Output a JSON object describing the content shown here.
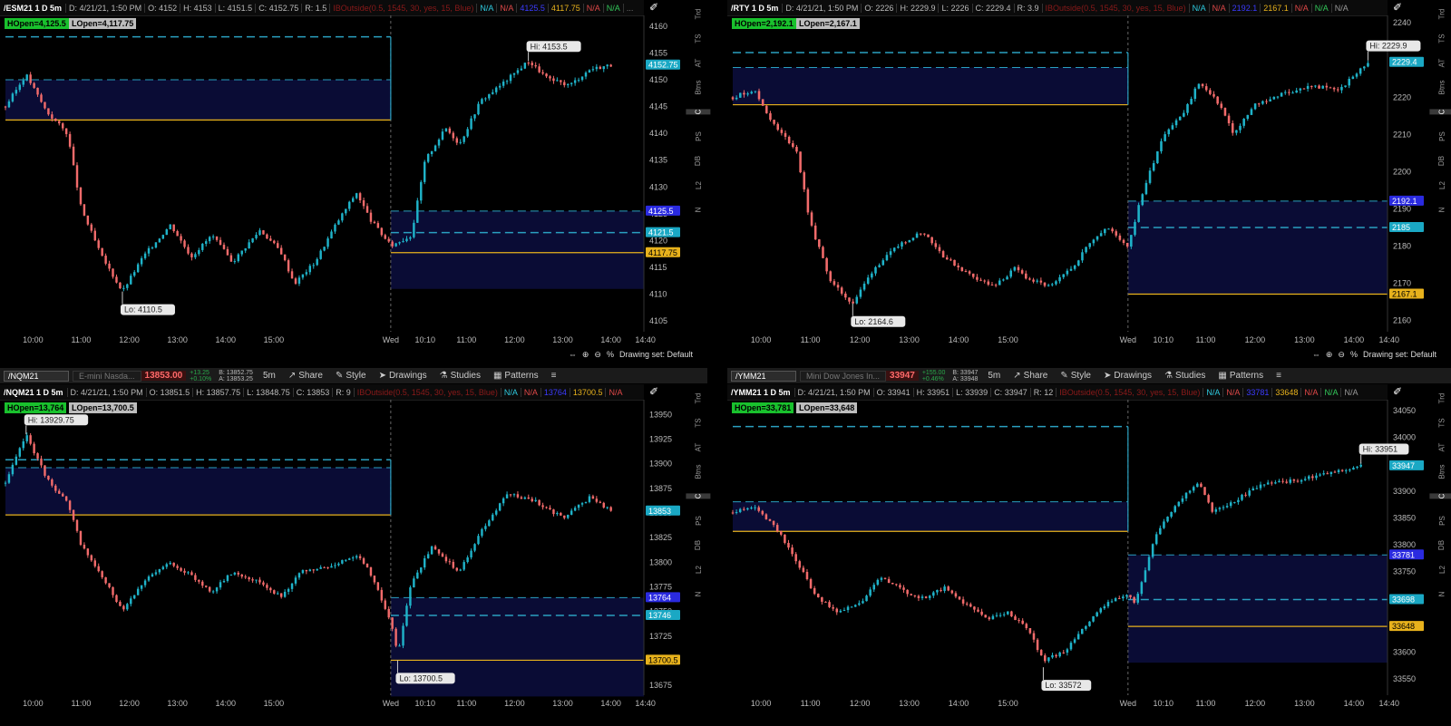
{
  "panels": [
    {
      "id": "esm",
      "symbol": "/ESM21 1 D 5m",
      "toolbar": null,
      "header_items": [
        {
          "t": "D: 4/21/21, 1:50 PM",
          "c": "it"
        },
        {
          "t": "O: 4152",
          "c": "it"
        },
        {
          "t": "H: 4153",
          "c": "it"
        },
        {
          "t": "L: 4151.5",
          "c": "it"
        },
        {
          "t": "C: 4152.75",
          "c": "it"
        },
        {
          "t": "R: 1.5",
          "c": "it"
        },
        {
          "t": "IBOutside(0.5, 1545, 30, yes, 15, Blue)",
          "c": "st"
        },
        {
          "t": "N/A",
          "c": "na-c"
        },
        {
          "t": "N/A",
          "c": "na-r"
        },
        {
          "t": "4125.5",
          "c": "bl"
        },
        {
          "t": "4117.75",
          "c": "yl"
        },
        {
          "t": "N/A",
          "c": "na-r"
        },
        {
          "t": "N/A",
          "c": "na-g"
        },
        {
          "t": "...",
          "c": "dots"
        }
      ],
      "hopen": "HOpen=4,125.5",
      "lopen": "LOpen=4,117.75",
      "y_ticks": [
        4160,
        4155,
        4150,
        4145,
        4140,
        4135,
        4130,
        4125,
        4120,
        4115,
        4110,
        4105
      ],
      "x_ticks": [
        "10:00",
        "11:00",
        "12:00",
        "13:00",
        "14:00",
        "15:00",
        "Wed",
        "10:10",
        "11:00",
        "12:00",
        "13:00",
        "14:00",
        "14:40"
      ],
      "price_tags": [
        {
          "v": "4152.75",
          "bg": "#1aa8c4",
          "fg": "#fff"
        },
        {
          "v": "4125.5",
          "bg": "#2a2ae0",
          "fg": "#fff"
        },
        {
          "v": "4121.5",
          "bg": "#1aa8c4",
          "fg": "#fff"
        },
        {
          "v": "4117.75",
          "bg": "#e8b21c",
          "fg": "#000"
        }
      ],
      "hi_label": "Hi: 4153.5",
      "lo_label": "Lo: 4110.5",
      "status": "Drawing set: Default",
      "side_buttons": [
        "Trd",
        "TS",
        "AT",
        "Btns",
        "C",
        "PS",
        "DB",
        "L2",
        "N"
      ],
      "colors": {
        "up": "#1fb3c9",
        "down": "#f26b6b",
        "ib_fill": "#0a0c35",
        "ib_line": "#2aa0c0",
        "lopen_line": "#e8b21c"
      },
      "chart_data": {
        "type": "candlestick",
        "title": "/ESM21 1 D 5m",
        "ylim": [
          4103,
          4162
        ],
        "day_split_fraction": 0.56,
        "y_levels": {
          "ib_high_prev": 4158,
          "ib_fill_top_prev": 4150,
          "lopen_prev": 4142.5,
          "ib_high": 4125.5,
          "ib_mid": 4121.5,
          "lopen": 4117.75
        },
        "hi": 4153.5,
        "lo": 4110.5,
        "path": [
          [
            0,
            4145
          ],
          [
            0.03,
            4151
          ],
          [
            0.06,
            4144
          ],
          [
            0.09,
            4140
          ],
          [
            0.11,
            4126
          ],
          [
            0.14,
            4117
          ],
          [
            0.17,
            4110.5
          ],
          [
            0.2,
            4117
          ],
          [
            0.24,
            4123
          ],
          [
            0.27,
            4117
          ],
          [
            0.3,
            4121
          ],
          [
            0.33,
            4116
          ],
          [
            0.37,
            4122
          ],
          [
            0.4,
            4118
          ],
          [
            0.42,
            4112
          ],
          [
            0.45,
            4116
          ],
          [
            0.48,
            4123
          ],
          [
            0.51,
            4129
          ],
          [
            0.53,
            4124
          ],
          [
            0.56,
            4119
          ],
          [
            0.59,
            4121
          ],
          [
            0.61,
            4135
          ],
          [
            0.64,
            4141
          ],
          [
            0.66,
            4138
          ],
          [
            0.69,
            4146
          ],
          [
            0.72,
            4149
          ],
          [
            0.76,
            4153.5
          ],
          [
            0.79,
            4150
          ],
          [
            0.82,
            4149
          ],
          [
            0.85,
            4152
          ],
          [
            0.88,
            4152.75
          ]
        ]
      }
    },
    {
      "id": "rty",
      "symbol": "/RTY 1 D 5m",
      "toolbar": null,
      "header_items": [
        {
          "t": "D: 4/21/21, 1:50 PM",
          "c": "it"
        },
        {
          "t": "O: 2226",
          "c": "it"
        },
        {
          "t": "H: 2229.9",
          "c": "it"
        },
        {
          "t": "L: 2226",
          "c": "it"
        },
        {
          "t": "C: 2229.4",
          "c": "it"
        },
        {
          "t": "R: 3.9",
          "c": "it"
        },
        {
          "t": "IBOutside(0.5, 1545, 30, yes, 15, Blue)",
          "c": "st"
        },
        {
          "t": "N/A",
          "c": "na-c"
        },
        {
          "t": "N/A",
          "c": "na-r"
        },
        {
          "t": "2192.1",
          "c": "bl"
        },
        {
          "t": "2167.1",
          "c": "yl"
        },
        {
          "t": "N/A",
          "c": "na-r"
        },
        {
          "t": "N/A",
          "c": "na-g"
        },
        {
          "t": "N/A",
          "c": "na-w"
        }
      ],
      "hopen": "HOpen=2,192.1",
      "lopen": "LOpen=2,167.1",
      "y_ticks": [
        2240,
        2230,
        2220,
        2210,
        2200,
        2190,
        2180,
        2170,
        2160
      ],
      "x_ticks": [
        "10:00",
        "11:00",
        "12:00",
        "13:00",
        "14:00",
        "15:00",
        "Wed",
        "10:10",
        "11:00",
        "12:00",
        "13:00",
        "14:00",
        "14:40"
      ],
      "price_tags": [
        {
          "v": "2229.4",
          "bg": "#1aa8c4",
          "fg": "#fff"
        },
        {
          "v": "2192.1",
          "bg": "#2a2ae0",
          "fg": "#fff"
        },
        {
          "v": "2185",
          "bg": "#1aa8c4",
          "fg": "#fff"
        },
        {
          "v": "2167.1",
          "bg": "#e8b21c",
          "fg": "#000"
        }
      ],
      "hi_label": "Hi: 2229.9",
      "lo_label": "Lo: 2164.6",
      "status": "Drawing set: Default",
      "side_buttons": [
        "Trd",
        "TS",
        "AT",
        "Btns",
        "C",
        "PS",
        "DB",
        "L2",
        "N"
      ],
      "colors": {
        "up": "#1fb3c9",
        "down": "#f26b6b",
        "ib_fill": "#0a0c35",
        "ib_line": "#2aa0c0",
        "lopen_line": "#e8b21c"
      },
      "chart_data": {
        "type": "candlestick",
        "title": "/RTY 1 D 5m",
        "ylim": [
          2157,
          2242
        ],
        "day_split_fraction": 0.56,
        "y_levels": {
          "ib_high_prev": 2232,
          "ib_fill_top_prev": 2228,
          "lopen_prev": 2218,
          "ib_high": 2192.1,
          "ib_mid": 2185,
          "lopen": 2167.1
        },
        "hi": 2229.9,
        "lo": 2164.6,
        "path": [
          [
            0,
            2220
          ],
          [
            0.03,
            2222
          ],
          [
            0.06,
            2212
          ],
          [
            0.09,
            2206
          ],
          [
            0.11,
            2186
          ],
          [
            0.14,
            2170
          ],
          [
            0.17,
            2164.6
          ],
          [
            0.2,
            2174
          ],
          [
            0.24,
            2181
          ],
          [
            0.27,
            2184
          ],
          [
            0.3,
            2177
          ],
          [
            0.33,
            2173
          ],
          [
            0.37,
            2169
          ],
          [
            0.4,
            2174
          ],
          [
            0.42,
            2171
          ],
          [
            0.45,
            2169
          ],
          [
            0.48,
            2174
          ],
          [
            0.51,
            2182
          ],
          [
            0.53,
            2185
          ],
          [
            0.56,
            2180
          ],
          [
            0.58,
            2194
          ],
          [
            0.61,
            2210
          ],
          [
            0.64,
            2216
          ],
          [
            0.66,
            2224
          ],
          [
            0.69,
            2218
          ],
          [
            0.71,
            2210
          ],
          [
            0.74,
            2218
          ],
          [
            0.78,
            2221
          ],
          [
            0.82,
            2223
          ],
          [
            0.86,
            2222
          ],
          [
            0.9,
            2229.4
          ]
        ]
      }
    },
    {
      "id": "nqm",
      "symbol": "/NQM21 1 D 5m",
      "toolbar": {
        "sym": "/NQM21",
        "desc": "E-mini Nasda...",
        "price": "13853.00",
        "chg": [
          "+13.25",
          "+0.10%"
        ],
        "bid": [
          "B: 13852.75",
          "A: 13853.25"
        ],
        "items": [
          "Share",
          "Style",
          "Drawings",
          "Studies",
          "Patterns"
        ],
        "interval": "5m"
      },
      "header_items": [
        {
          "t": "D: 4/21/21, 1:50 PM",
          "c": "it"
        },
        {
          "t": "O: 13851.5",
          "c": "it"
        },
        {
          "t": "H: 13857.75",
          "c": "it"
        },
        {
          "t": "L: 13848.75",
          "c": "it"
        },
        {
          "t": "C: 13853",
          "c": "it"
        },
        {
          "t": "R: 9",
          "c": "it"
        },
        {
          "t": "IBOutside(0.5, 1545, 30, yes, 15, Blue)",
          "c": "st"
        },
        {
          "t": "N/A",
          "c": "na-c"
        },
        {
          "t": "N/A",
          "c": "na-r"
        },
        {
          "t": "13764",
          "c": "bl"
        },
        {
          "t": "13700.5",
          "c": "yl"
        },
        {
          "t": "N/A",
          "c": "na-r"
        }
      ],
      "hopen": "HOpen=13,764",
      "lopen": "LOpen=13,700.5",
      "y_ticks": [
        13950,
        13925,
        13900,
        13875,
        13850,
        13825,
        13800,
        13775,
        13750,
        13725,
        13700,
        13675
      ],
      "x_ticks": [
        "10:00",
        "11:00",
        "12:00",
        "13:00",
        "14:00",
        "15:00",
        "Wed",
        "10:10",
        "11:00",
        "12:00",
        "13:00",
        "14:00",
        "14:40"
      ],
      "price_tags": [
        {
          "v": "13853",
          "bg": "#1aa8c4",
          "fg": "#fff"
        },
        {
          "v": "13764",
          "bg": "#2a2ae0",
          "fg": "#fff"
        },
        {
          "v": "13746",
          "bg": "#1aa8c4",
          "fg": "#fff"
        },
        {
          "v": "13700.5",
          "bg": "#e8b21c",
          "fg": "#000"
        }
      ],
      "hi_label": "Hi: 13929.75",
      "lo_label": "Lo: 13700.5",
      "status": "",
      "side_buttons": [
        "Trd",
        "TS",
        "AT",
        "Btns",
        "C",
        "PS",
        "DB",
        "L2",
        "N"
      ],
      "colors": {
        "up": "#1fb3c9",
        "down": "#f26b6b",
        "ib_fill": "#0a0c35",
        "ib_line": "#2aa0c0",
        "lopen_line": "#e8b21c"
      },
      "chart_data": {
        "type": "candlestick",
        "title": "/NQM21 1 D 5m",
        "ylim": [
          13665,
          13965
        ],
        "day_split_fraction": 0.56,
        "y_levels": {
          "ib_high_prev": 13904,
          "ib_fill_top_prev": 13896,
          "lopen_prev": 13848,
          "ib_high": 13764,
          "ib_mid": 13746,
          "lopen": 13700.5
        },
        "hi": 13929.75,
        "lo": 13700.5,
        "path": [
          [
            0,
            13880
          ],
          [
            0.03,
            13929.75
          ],
          [
            0.06,
            13885
          ],
          [
            0.09,
            13860
          ],
          [
            0.11,
            13818
          ],
          [
            0.14,
            13785
          ],
          [
            0.17,
            13752
          ],
          [
            0.2,
            13780
          ],
          [
            0.24,
            13800
          ],
          [
            0.27,
            13786
          ],
          [
            0.3,
            13770
          ],
          [
            0.33,
            13790
          ],
          [
            0.37,
            13780
          ],
          [
            0.4,
            13765
          ],
          [
            0.43,
            13790
          ],
          [
            0.47,
            13795
          ],
          [
            0.51,
            13808
          ],
          [
            0.53,
            13790
          ],
          [
            0.56,
            13740
          ],
          [
            0.57,
            13705
          ],
          [
            0.59,
            13780
          ],
          [
            0.62,
            13815
          ],
          [
            0.66,
            13790
          ],
          [
            0.69,
            13830
          ],
          [
            0.73,
            13870
          ],
          [
            0.77,
            13862
          ],
          [
            0.81,
            13845
          ],
          [
            0.85,
            13866
          ],
          [
            0.88,
            13852
          ]
        ]
      }
    },
    {
      "id": "ymm",
      "symbol": "/YMM21 1 D 5m",
      "toolbar": {
        "sym": "/YMM21",
        "desc": "Mini Dow Jones In...",
        "price": "33947",
        "chg": [
          "+155.00",
          "+0.46%"
        ],
        "bid": [
          "B: 33947",
          "A: 33948"
        ],
        "items": [
          "Share",
          "Style",
          "Drawings",
          "Studies",
          "Patterns"
        ],
        "interval": "5m"
      },
      "header_items": [
        {
          "t": "D: 4/21/21, 1:50 PM",
          "c": "it"
        },
        {
          "t": "O: 33941",
          "c": "it"
        },
        {
          "t": "H: 33951",
          "c": "it"
        },
        {
          "t": "L: 33939",
          "c": "it"
        },
        {
          "t": "C: 33947",
          "c": "it"
        },
        {
          "t": "R: 12",
          "c": "it"
        },
        {
          "t": "IBOutside(0.5, 1545, 30, yes, 15, Blue)",
          "c": "st"
        },
        {
          "t": "N/A",
          "c": "na-c"
        },
        {
          "t": "N/A",
          "c": "na-r"
        },
        {
          "t": "33781",
          "c": "bl"
        },
        {
          "t": "33648",
          "c": "yl"
        },
        {
          "t": "N/A",
          "c": "na-r"
        },
        {
          "t": "N/A",
          "c": "na-g"
        },
        {
          "t": "N/A",
          "c": "na-w"
        }
      ],
      "hopen": "HOpen=33,781",
      "lopen": "LOpen=33,648",
      "y_ticks": [
        34050,
        34000,
        33950,
        33900,
        33850,
        33800,
        33750,
        33700,
        33650,
        33600,
        33550
      ],
      "x_ticks": [
        "10:00",
        "11:00",
        "12:00",
        "13:00",
        "14:00",
        "15:00",
        "Wed",
        "10:10",
        "11:00",
        "12:00",
        "13:00",
        "14:00",
        "14:40"
      ],
      "price_tags": [
        {
          "v": "33947",
          "bg": "#1aa8c4",
          "fg": "#fff"
        },
        {
          "v": "33781",
          "bg": "#2a2ae0",
          "fg": "#fff"
        },
        {
          "v": "33698",
          "bg": "#1aa8c4",
          "fg": "#fff"
        },
        {
          "v": "33648",
          "bg": "#e8b21c",
          "fg": "#000"
        }
      ],
      "hi_label": "Hi: 33951",
      "lo_label": "Lo: 33572",
      "status": "",
      "side_buttons": [
        "Trd",
        "TS",
        "AT",
        "Btns",
        "C",
        "PS",
        "DB",
        "L2",
        "N"
      ],
      "colors": {
        "up": "#1fb3c9",
        "down": "#f26b6b",
        "ib_fill": "#0a0c35",
        "ib_line": "#2aa0c0",
        "lopen_line": "#e8b21c"
      },
      "chart_data": {
        "type": "candlestick",
        "title": "/YMM21 1 D 5m",
        "ylim": [
          33520,
          34070
        ],
        "day_split_fraction": 0.56,
        "y_levels": {
          "ib_high_prev": 34020,
          "ib_fill_top_prev": 33880,
          "lopen_prev": 33825,
          "ib_high": 33781,
          "ib_mid": 33698,
          "lopen": 33648
        },
        "hi": 33951,
        "lo": 33572,
        "path": [
          [
            0,
            33860
          ],
          [
            0.03,
            33870
          ],
          [
            0.06,
            33835
          ],
          [
            0.09,
            33770
          ],
          [
            0.12,
            33700
          ],
          [
            0.15,
            33675
          ],
          [
            0.18,
            33690
          ],
          [
            0.21,
            33740
          ],
          [
            0.24,
            33715
          ],
          [
            0.27,
            33700
          ],
          [
            0.3,
            33720
          ],
          [
            0.33,
            33690
          ],
          [
            0.36,
            33660
          ],
          [
            0.39,
            33675
          ],
          [
            0.42,
            33640
          ],
          [
            0.44,
            33585
          ],
          [
            0.47,
            33600
          ],
          [
            0.5,
            33650
          ],
          [
            0.53,
            33690
          ],
          [
            0.56,
            33710
          ],
          [
            0.57,
            33690
          ],
          [
            0.6,
            33820
          ],
          [
            0.63,
            33880
          ],
          [
            0.66,
            33915
          ],
          [
            0.68,
            33860
          ],
          [
            0.71,
            33880
          ],
          [
            0.75,
            33915
          ],
          [
            0.8,
            33920
          ],
          [
            0.85,
            33935
          ],
          [
            0.89,
            33947
          ]
        ]
      }
    }
  ]
}
